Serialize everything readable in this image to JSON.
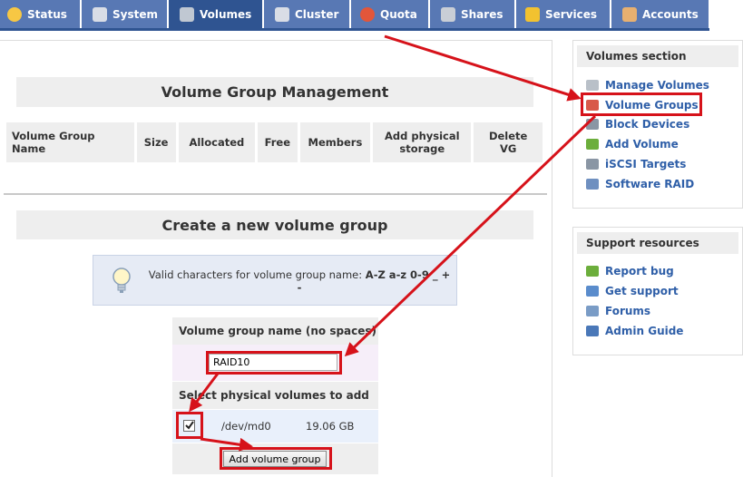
{
  "nav": {
    "tabs": [
      {
        "label": "Status",
        "icon": "sun-icon",
        "color": "#f7c744"
      },
      {
        "label": "System",
        "icon": "monitor-icon",
        "color": "#d9dde6"
      },
      {
        "label": "Volumes",
        "icon": "disk-icon",
        "color": "#c0c8d2"
      },
      {
        "label": "Cluster",
        "icon": "cluster-icon",
        "color": "#d9dde6"
      },
      {
        "label": "Quota",
        "icon": "pie-chart-icon",
        "color": "#e2563a"
      },
      {
        "label": "Shares",
        "icon": "server-icon",
        "color": "#c9ced6"
      },
      {
        "label": "Services",
        "icon": "lightning-icon",
        "color": "#f2c230"
      },
      {
        "label": "Accounts",
        "icon": "user-icon",
        "color": "#e8b070"
      }
    ],
    "active_tab": "Volumes"
  },
  "main": {
    "title": "Volume Group Management",
    "table_headers": [
      "Volume Group Name",
      "Size",
      "Allocated",
      "Free",
      "Members",
      "Add physical storage",
      "Delete VG"
    ],
    "create_title": "Create a new volume group",
    "info_text": "Valid characters for volume group name:",
    "info_chars": "A-Z a-z 0-9 _ + -",
    "form": {
      "name_label": "Volume group name (no spaces)",
      "name_value": "RAID10",
      "pv_label": "Select physical volumes to add",
      "pv_device": "/dev/md0",
      "pv_size": "19.06 GB",
      "pv_checked": true,
      "submit_label": "Add volume group"
    }
  },
  "sidebar": {
    "volumes_title": "Volumes section",
    "volumes_links": [
      {
        "label": "Manage Volumes",
        "icon": "disk-icon",
        "color": "#b9c0c8"
      },
      {
        "label": "Volume Groups",
        "icon": "volume-groups-icon",
        "color": "#d85a4a"
      },
      {
        "label": "Block Devices",
        "icon": "block-devices-icon",
        "color": "#8a96a4"
      },
      {
        "label": "Add Volume",
        "icon": "add-volume-icon",
        "color": "#6cae3c"
      },
      {
        "label": "iSCSI Targets",
        "icon": "iscsi-icon",
        "color": "#8a96a4"
      },
      {
        "label": "Software RAID",
        "icon": "raid-icon",
        "color": "#6f90c0"
      }
    ],
    "support_title": "Support resources",
    "support_links": [
      {
        "label": "Report bug",
        "icon": "bug-icon",
        "color": "#6cae3c"
      },
      {
        "label": "Get support",
        "icon": "support-icon",
        "color": "#5a8ccc"
      },
      {
        "label": "Forums",
        "icon": "forums-icon",
        "color": "#7a9cc6"
      },
      {
        "label": "Admin Guide",
        "icon": "guide-icon",
        "color": "#4a78b8"
      }
    ]
  },
  "annotation_color": "#d6121a"
}
